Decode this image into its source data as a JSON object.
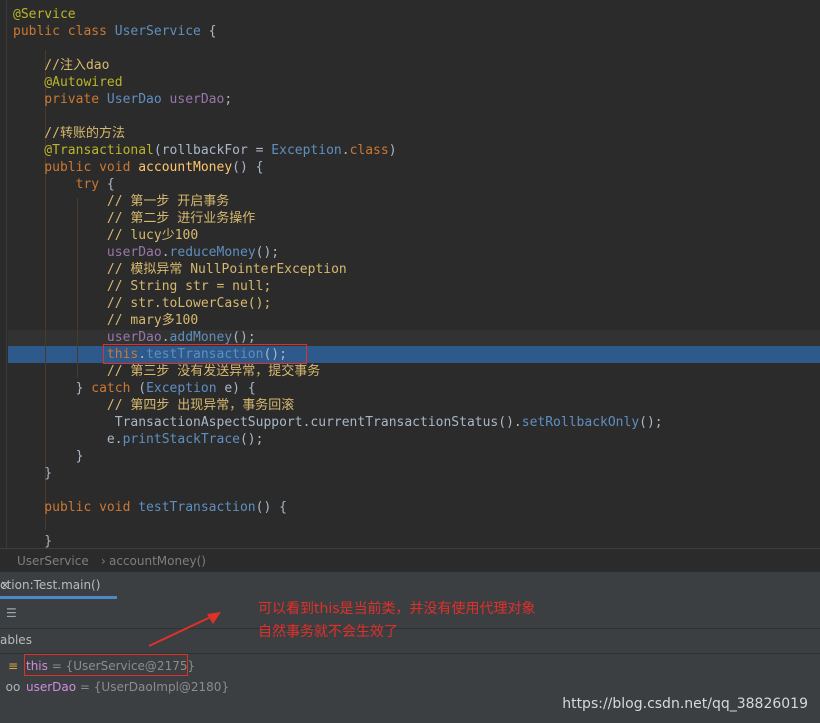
{
  "code": {
    "lines": [
      {
        "segs": [
          [
            "ann",
            "@Service"
          ]
        ]
      },
      {
        "segs": [
          [
            "kw",
            "public class "
          ],
          [
            "blue",
            "UserService"
          ],
          [
            "nm",
            " {"
          ]
        ]
      },
      {
        "segs": [
          [
            "nm",
            ""
          ]
        ]
      },
      {
        "segs": [
          [
            "cmt-y",
            "    //注入dao"
          ]
        ]
      },
      {
        "segs": [
          [
            "ann",
            "    @Autowired"
          ]
        ]
      },
      {
        "segs": [
          [
            "kw",
            "    private "
          ],
          [
            "blue",
            "UserDao "
          ],
          [
            "field",
            "userDao"
          ],
          [
            "nm",
            ";"
          ]
        ]
      },
      {
        "segs": [
          [
            "nm",
            ""
          ]
        ]
      },
      {
        "segs": [
          [
            "cmt-y",
            "    //转账的方法"
          ]
        ]
      },
      {
        "segs": [
          [
            "ann",
            "    @Transactional"
          ],
          [
            "nm",
            "(rollbackFor = "
          ],
          [
            "blue",
            "Exception"
          ],
          [
            "nm",
            "."
          ],
          [
            "kw",
            "class"
          ],
          [
            "nm",
            ")"
          ]
        ]
      },
      {
        "segs": [
          [
            "kw",
            "    public void "
          ],
          [
            "fn",
            "accountMoney"
          ],
          [
            "nm",
            "() {"
          ]
        ]
      },
      {
        "segs": [
          [
            "kw",
            "        try "
          ],
          [
            "nm",
            "{"
          ]
        ]
      },
      {
        "segs": [
          [
            "cmt-y",
            "            // 第一步 开启事务"
          ]
        ]
      },
      {
        "segs": [
          [
            "cmt-y",
            "            // 第二步 进行业务操作"
          ]
        ]
      },
      {
        "segs": [
          [
            "cmt-y",
            "            // lucy少100"
          ]
        ]
      },
      {
        "segs": [
          [
            "field",
            "            userDao"
          ],
          [
            "nm",
            "."
          ],
          [
            "blue",
            "reduceMoney"
          ],
          [
            "nm",
            "();"
          ]
        ]
      },
      {
        "segs": [
          [
            "cmt-y",
            "            // 模拟异常 NullPointerException"
          ]
        ]
      },
      {
        "segs": [
          [
            "cmt-y",
            "            // String str = null;"
          ]
        ]
      },
      {
        "segs": [
          [
            "cmt-y",
            "            // str.toLowerCase();"
          ]
        ]
      },
      {
        "segs": [
          [
            "cmt-y",
            "            // mary多100"
          ]
        ]
      },
      {
        "segs": [
          [
            "field",
            "            userDao"
          ],
          [
            "nm",
            "."
          ],
          [
            "blue",
            "addMoney"
          ],
          [
            "nm",
            "();"
          ]
        ]
      },
      {
        "segs": [
          [
            "kw",
            "            this"
          ],
          [
            "nm",
            "."
          ],
          [
            "blue",
            "testTransaction"
          ],
          [
            "nm",
            "();"
          ]
        ]
      },
      {
        "segs": [
          [
            "cmt-y",
            "            // 第三步 没有发送异常，提交事务"
          ]
        ]
      },
      {
        "segs": [
          [
            "nm",
            "        } "
          ],
          [
            "kw",
            "catch "
          ],
          [
            "nm",
            "("
          ],
          [
            "blue",
            "Exception "
          ],
          [
            "nm",
            "e) {"
          ]
        ]
      },
      {
        "segs": [
          [
            "cmt-y",
            "            // 第四步 出现异常，事务回滚"
          ]
        ]
      },
      {
        "segs": [
          [
            "nm",
            "             TransactionAspectSupport."
          ],
          [
            "nm",
            "currentTransactionStatus"
          ],
          [
            "nm",
            "()."
          ],
          [
            "blue",
            "setRollbackOnly"
          ],
          [
            "nm",
            "();"
          ]
        ]
      },
      {
        "segs": [
          [
            "nm",
            "            e."
          ],
          [
            "blue",
            "printStackTrace"
          ],
          [
            "nm",
            "();"
          ]
        ]
      },
      {
        "segs": [
          [
            "nm",
            "        }"
          ]
        ]
      },
      {
        "segs": [
          [
            "nm",
            "    }"
          ]
        ]
      },
      {
        "segs": [
          [
            "nm",
            ""
          ]
        ]
      },
      {
        "segs": [
          [
            "kw",
            "    public void "
          ],
          [
            "blue",
            "testTransaction"
          ],
          [
            "nm",
            "() {"
          ]
        ]
      },
      {
        "segs": [
          [
            "nm",
            ""
          ]
        ]
      },
      {
        "segs": [
          [
            "nm",
            "    }"
          ]
        ]
      }
    ]
  },
  "breadcrumb": {
    "class_name": "UserService",
    "separator": "›",
    "method_name": "accountMoney()"
  },
  "debug": {
    "tab_label": "ction:Test.main()",
    "tab_close": "×",
    "variables_label": "ables",
    "variables": [
      {
        "name": "this",
        "eq": " = ",
        "value": "{UserService@2175}",
        "icon": "≡"
      },
      {
        "name": "userDao",
        "eq": " = ",
        "value": "{UserDaoImpl@2180}",
        "icon": "oo"
      }
    ]
  },
  "annotation": {
    "line1": "可以看到this是当前类，并没有使用代理对象",
    "line2": "自然事务就不会生效了"
  },
  "watermark": "https://blog.csdn.net/qq_38826019",
  "colors": {
    "editor_bg": "#2b2b2b",
    "highlight": "#2d5a8a",
    "annotation_red": "#e0302a"
  }
}
